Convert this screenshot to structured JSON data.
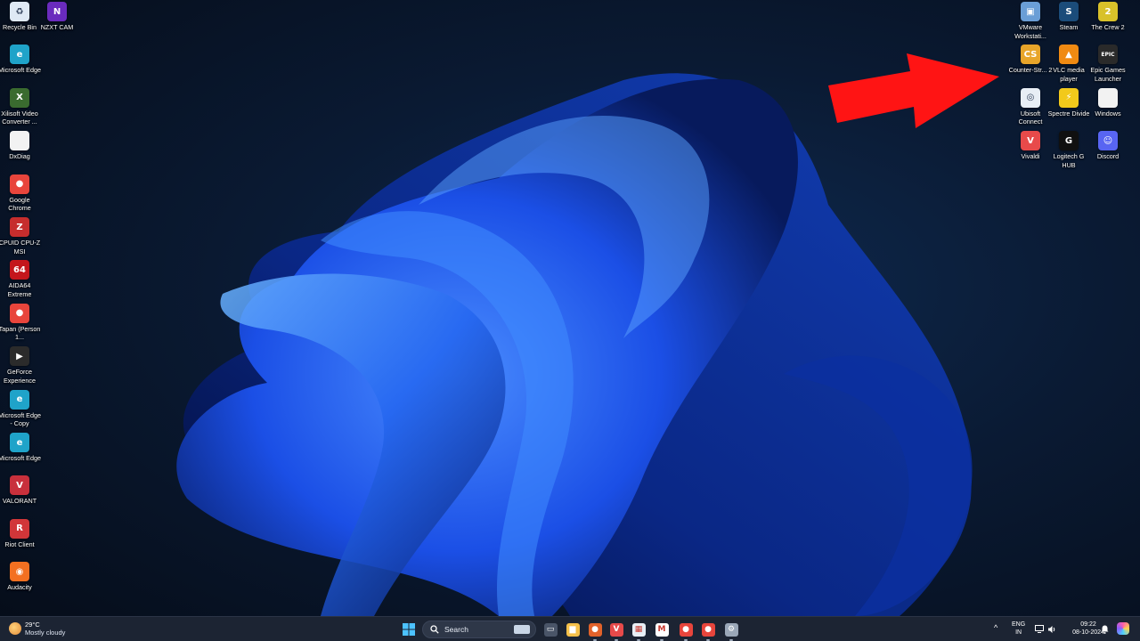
{
  "desktop": {
    "left_icons": [
      {
        "label": "Recycle Bin",
        "icon": "recycle-bin-icon",
        "color": "#dfe9f5",
        "glyph": "♻"
      },
      {
        "label": "NZXT CAM",
        "icon": "nzxt-cam-icon",
        "color": "#6a2bbd",
        "glyph": "N"
      },
      {
        "label": "Microsoft Edge",
        "icon": "edge-icon",
        "color": "#1fa3c9",
        "glyph": "e"
      },
      {
        "label": "Xilisoft Video Converter ...",
        "icon": "xilisoft-icon",
        "color": "#3a6b2f",
        "glyph": "X"
      },
      {
        "label": "DxDiag",
        "icon": "document-icon",
        "color": "#f2f2f2",
        "glyph": ""
      },
      {
        "label": "Google Chrome",
        "icon": "chrome-icon",
        "color": "#e8453c",
        "glyph": "●"
      },
      {
        "label": "CPUID CPU-Z MSI",
        "icon": "cpuz-icon",
        "color": "#c62d2d",
        "glyph": "Z"
      },
      {
        "label": "AIDA64 Extreme",
        "icon": "aida64-icon",
        "color": "#c4161c",
        "glyph": "64"
      },
      {
        "label": "Tapan (Person 1...",
        "icon": "chrome-profile-icon",
        "color": "#e8453c",
        "glyph": "●"
      },
      {
        "label": "GeForce Experience",
        "icon": "geforce-icon",
        "color": "#2b2b2b",
        "glyph": "▶"
      },
      {
        "label": "Microsoft Edge - Copy",
        "icon": "edge-copy-icon",
        "color": "#1fa3c9",
        "glyph": "e"
      },
      {
        "label": "Microsoft Edge",
        "icon": "edge-icon-2",
        "color": "#1fa3c9",
        "glyph": "e"
      },
      {
        "label": "VALORANT",
        "icon": "valorant-icon",
        "color": "#c8303c",
        "glyph": "V"
      },
      {
        "label": "Riot Client",
        "icon": "riot-client-icon",
        "color": "#d13639",
        "glyph": "R"
      },
      {
        "label": "Audacity",
        "icon": "audacity-icon",
        "color": "#f37021",
        "glyph": "◉"
      }
    ],
    "right_icons": [
      {
        "label": "VMware Workstati...",
        "icon": "vmware-icon",
        "color": "#6a9ed6",
        "glyph": "▣"
      },
      {
        "label": "Steam",
        "icon": "steam-icon",
        "color": "#1b4c7a",
        "glyph": "S"
      },
      {
        "label": "The Crew 2",
        "icon": "the-crew-2-icon",
        "color": "#d8c12a",
        "glyph": "2"
      },
      {
        "label": "Counter-Str... 2",
        "icon": "counter-strike-icon",
        "color": "#e8a52a",
        "glyph": "CS"
      },
      {
        "label": "VLC media player",
        "icon": "vlc-icon",
        "color": "#f08a12",
        "glyph": "▲"
      },
      {
        "label": "Epic Games Launcher",
        "icon": "epic-games-icon",
        "color": "#2a2a2a",
        "glyph": "EPIC"
      },
      {
        "label": "Ubisoft Connect",
        "icon": "ubisoft-icon",
        "color": "#e8eef5",
        "glyph": "◎"
      },
      {
        "label": "Spectre Divide",
        "icon": "spectre-divide-icon",
        "color": "#f2c91b",
        "glyph": "⚡"
      },
      {
        "label": "Windows",
        "icon": "windows-file-icon",
        "color": "#f2f2f2",
        "glyph": ""
      },
      {
        "label": "Vivaldi",
        "icon": "vivaldi-icon",
        "color": "#e84a4a",
        "glyph": "V"
      },
      {
        "label": "Logitech G HUB",
        "icon": "logitech-ghub-icon",
        "color": "#101010",
        "glyph": "G"
      },
      {
        "label": "Discord",
        "icon": "discord-icon",
        "color": "#5865f2",
        "glyph": "☺"
      }
    ]
  },
  "taskbar": {
    "weather_temp": "29°C",
    "weather_desc": "Mostly cloudy",
    "search_label": "Search",
    "apps": [
      {
        "name": "start-button",
        "color": "#3aa0ff",
        "glyph": "⊞"
      },
      {
        "name": "task-view-button",
        "color": "#4a5568",
        "glyph": "▭"
      },
      {
        "name": "file-explorer-button",
        "color": "#f5c04a",
        "glyph": "▆"
      },
      {
        "name": "taskbar-app-1",
        "color": "#e2622a",
        "glyph": "●"
      },
      {
        "name": "vivaldi-taskbar-button",
        "color": "#e84a4a",
        "glyph": "V"
      },
      {
        "name": "store-taskbar-button",
        "color": "#e8eef5",
        "glyph": "▦"
      },
      {
        "name": "gmail-taskbar-button",
        "color": "#ffffff",
        "glyph": "M"
      },
      {
        "name": "chrome-taskbar-button-1",
        "color": "#e8453c",
        "glyph": "●"
      },
      {
        "name": "chrome-taskbar-button-2",
        "color": "#e8453c",
        "glyph": "●"
      },
      {
        "name": "settings-taskbar-button",
        "color": "#9aa7b8",
        "glyph": "⚙"
      }
    ],
    "lang_line1": "ENG",
    "lang_line2": "IN",
    "time": "09:22",
    "date": "08-10-2024"
  },
  "colors": {
    "arrow": "#ff1414",
    "taskbar": "#1c2433"
  }
}
